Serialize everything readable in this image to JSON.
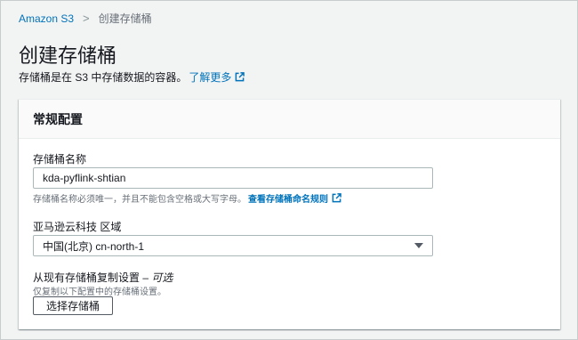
{
  "breadcrumb": {
    "root": "Amazon S3",
    "separator": ">",
    "current": "创建存储桶"
  },
  "page": {
    "title": "创建存储桶",
    "description": "存储桶是在 S3 中存储数据的容器。",
    "learn_more": "了解更多",
    "external_icon": "external-link-icon"
  },
  "general_config": {
    "header": "常规配置",
    "bucket_name_label": "存储桶名称",
    "bucket_name_value": "kda-pyflink-shtian",
    "bucket_name_hint": "存储桶名称必须唯一，并且不能包含空格或大写字母。",
    "bucket_name_rules_link": "查看存储桶命名规则",
    "region_label": "亚马逊云科技 区域",
    "region_value": "中国(北京) cn-north-1",
    "copy_label_main": "从现有存储桶复制设置 –",
    "copy_label_optional": "可选",
    "copy_hint": "仅复制以下配置中的存储桶设置。",
    "choose_bucket_button": "选择存储桶"
  },
  "colors": {
    "link": "#0073bb",
    "background": "#f2f3f3",
    "text": "#16191f"
  }
}
